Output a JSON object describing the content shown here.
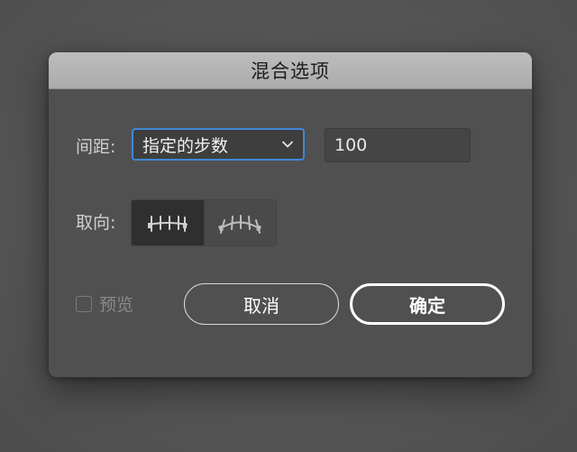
{
  "dialog": {
    "title": "混合选项"
  },
  "spacing": {
    "label": "间距:",
    "selected_option": "指定的步数",
    "value": "100"
  },
  "orientation": {
    "label": "取向:",
    "options": [
      "align-to-page-icon",
      "align-to-path-icon"
    ],
    "selected_index": 0
  },
  "preview": {
    "label": "预览",
    "checked": false
  },
  "buttons": {
    "cancel_label": "取消",
    "ok_label": "确定"
  },
  "colors": {
    "accent": "#3f88d6",
    "dialog_bg": "#505050"
  }
}
